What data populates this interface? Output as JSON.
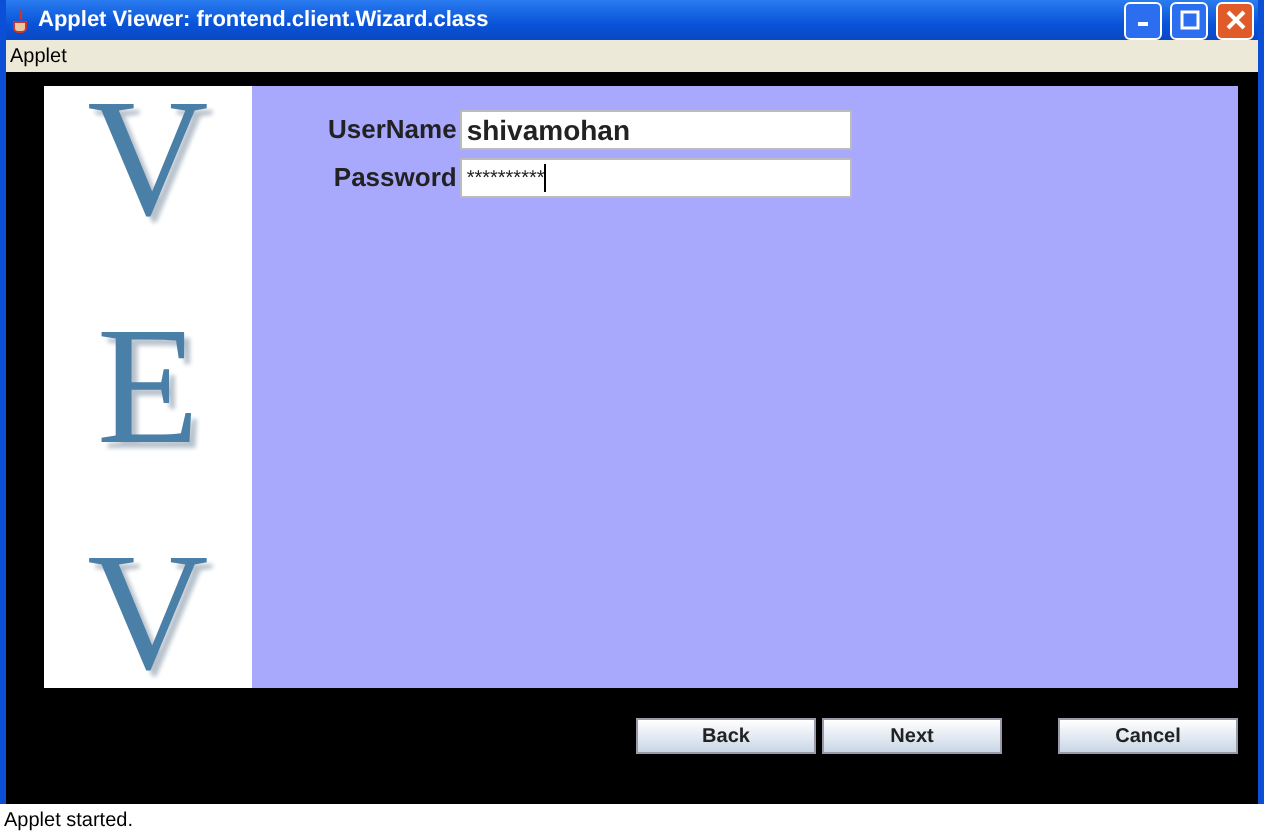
{
  "window": {
    "title": "Applet Viewer: frontend.client.Wizard.class"
  },
  "menu": [
    "Applet"
  ],
  "logo_letters": [
    "V",
    "E",
    "V"
  ],
  "form": [
    {
      "label": "UserName",
      "value": "shivamohan",
      "kind": "text"
    },
    {
      "label": "Password",
      "value": "**********",
      "kind": "password"
    }
  ],
  "buttons": [
    "Back",
    "Next",
    "Cancel"
  ],
  "status_bar": "Applet started."
}
